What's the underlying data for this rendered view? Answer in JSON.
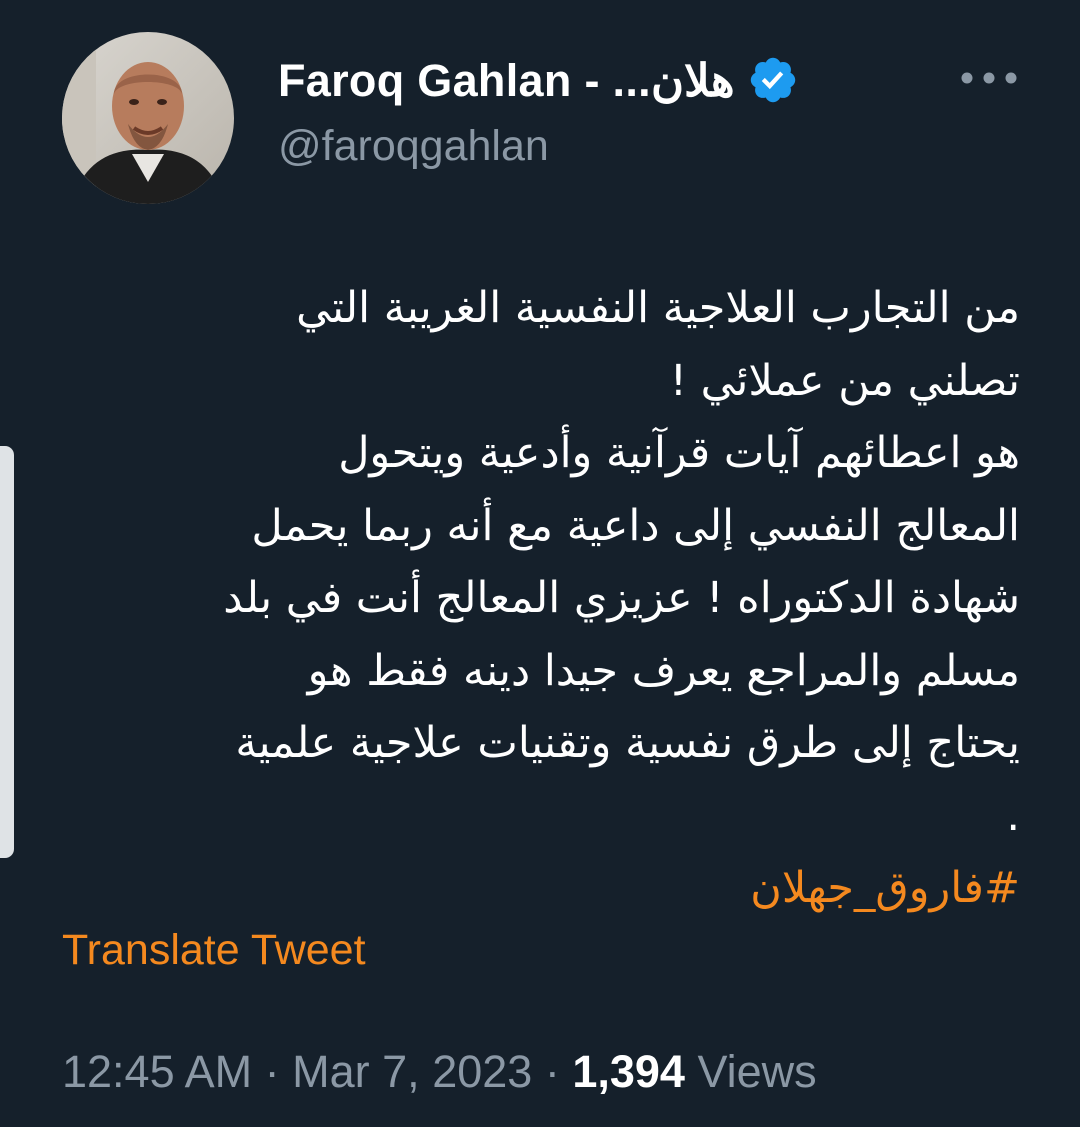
{
  "tweet": {
    "author": {
      "display_name": "Faroq Gahlan - جهلان...",
      "display_name_shown": "Faroq Gahlan - ...هلان",
      "handle": "@faroqgahlan",
      "verified_icon": "verified-badge-icon",
      "verified_color": "#1d9bf0",
      "avatar_icon": "profile-photo"
    },
    "more_icon": "more-horizontal-icon",
    "text_lines": [
      "من التجارب العلاجية النفسية الغريبة التي",
      "تصلني من عملائي !",
      "هو اعطائهم آيات قرآنية وأدعية ويتحول",
      "المعالج النفسي إلى داعية مع أنه ربما يحمل",
      "شهادة الدكتوراه ! عزيزي المعالج أنت في بلد",
      "مسلم والمراجع يعرف جيدا دينه فقط هو",
      "يحتاج إلى طرق نفسية وتقنيات علاجية علمية",
      "."
    ],
    "hashtag": "#فاروق_جهلان",
    "translate_label": "Translate Tweet",
    "time": "12:45 AM",
    "date": "Mar 7, 2023",
    "separator": "·",
    "views_count": "1,394",
    "views_label": "Views"
  },
  "colors": {
    "background": "#15202b",
    "accent": "#f4891f",
    "secondary_text": "#8b98a5",
    "primary_text": "#ffffff"
  }
}
